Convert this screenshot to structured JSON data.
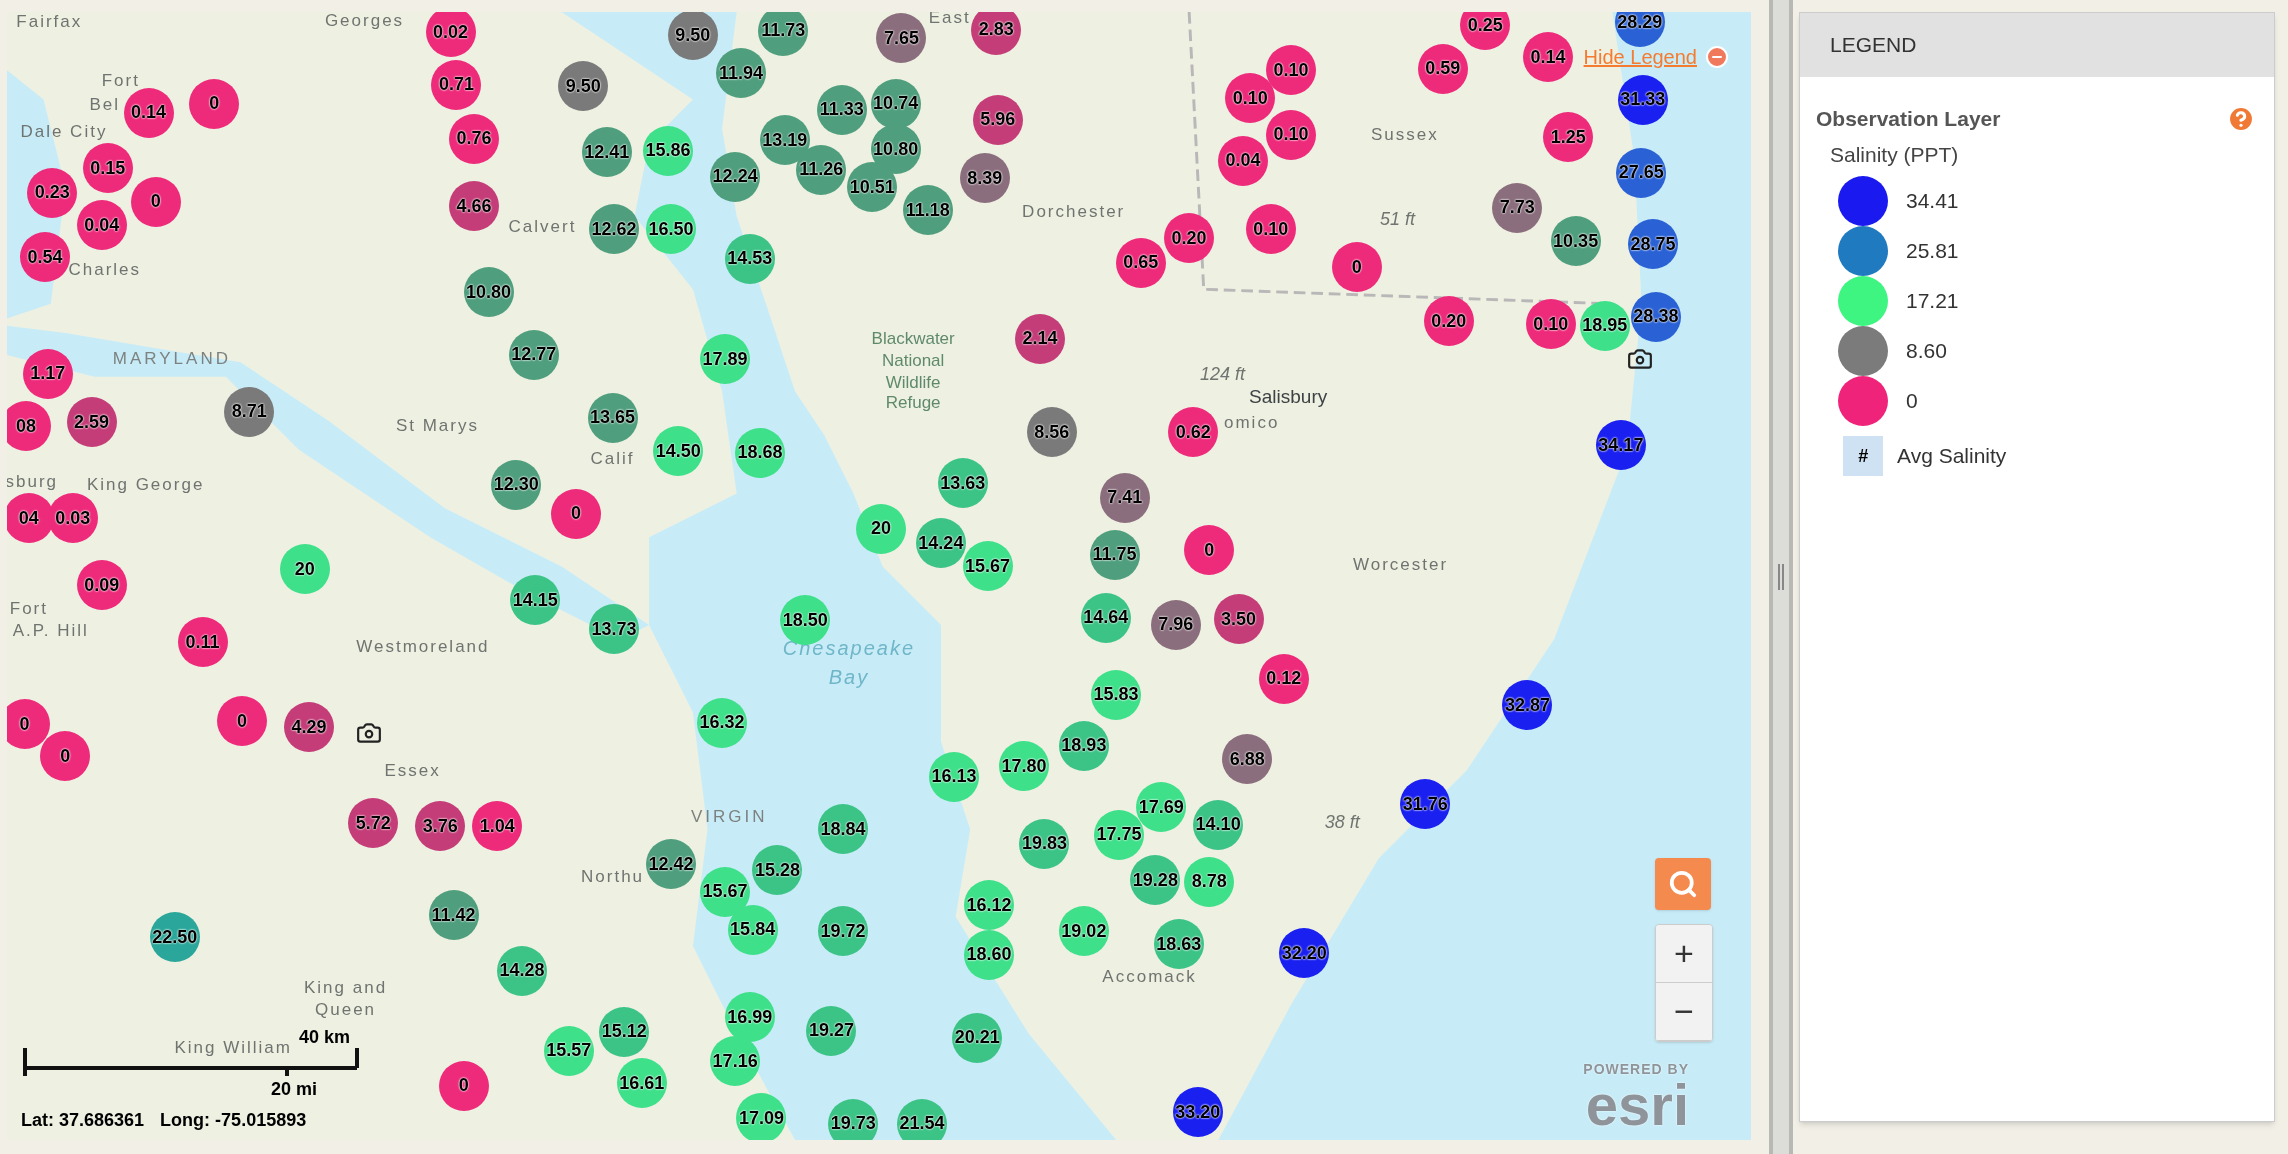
{
  "map": {
    "labels": [
      {
        "text": "Fairfax",
        "kind": "place"
      },
      {
        "text": "Georges",
        "kind": "place"
      },
      {
        "text": "East",
        "kind": "place"
      },
      {
        "text": "Fort",
        "kind": "place"
      },
      {
        "text": "Bel",
        "kind": "place"
      },
      {
        "text": "Dale City",
        "kind": "place"
      },
      {
        "text": "Charles",
        "kind": "place"
      },
      {
        "text": "Calvert",
        "kind": "place"
      },
      {
        "text": "MARYLAND",
        "kind": "state"
      },
      {
        "text": "St Marys",
        "kind": "place"
      },
      {
        "text": "Calif",
        "kind": "place"
      },
      {
        "text": "sburg",
        "kind": "place"
      },
      {
        "text": "King George",
        "kind": "place"
      },
      {
        "text": "Fort",
        "kind": "place"
      },
      {
        "text": "A.P. Hill",
        "kind": "place"
      },
      {
        "text": "Westmoreland",
        "kind": "place"
      },
      {
        "text": "Essex",
        "kind": "place"
      },
      {
        "text": "Northu",
        "kind": "place"
      },
      {
        "text": "VIRGIN",
        "kind": "state"
      },
      {
        "text": "King and",
        "kind": "place"
      },
      {
        "text": "Queen",
        "kind": "place"
      },
      {
        "text": "King William",
        "kind": "place"
      },
      {
        "text": "Blackwater",
        "kind": "refuge"
      },
      {
        "text": "National",
        "kind": "refuge"
      },
      {
        "text": "Wildlife",
        "kind": "refuge"
      },
      {
        "text": "Refuge",
        "kind": "refuge"
      },
      {
        "text": "Dorchester",
        "kind": "place"
      },
      {
        "text": "Sussex",
        "kind": "place"
      },
      {
        "text": "51 ft",
        "kind": "elevation"
      },
      {
        "text": "124 ft",
        "kind": "elevation"
      },
      {
        "text": "Salisbury",
        "kind": "town"
      },
      {
        "text": "omico",
        "kind": "place"
      },
      {
        "text": "Worcester",
        "kind": "place"
      },
      {
        "text": "Chesapeake",
        "kind": "water"
      },
      {
        "text": "Bay",
        "kind": "water"
      },
      {
        "text": "38 ft",
        "kind": "elevation"
      },
      {
        "text": "Accomack",
        "kind": "place"
      }
    ],
    "markers": [
      {
        "value": "0.02",
        "color": "#ee2a7b"
      },
      {
        "value": "0.14",
        "color": "#ee2a7b"
      },
      {
        "value": "0",
        "color": "#ee2a7b"
      },
      {
        "value": "0.71",
        "color": "#ee2a7b"
      },
      {
        "value": "0.76",
        "color": "#ee2a7b"
      },
      {
        "value": "0.15",
        "color": "#ee2a7b"
      },
      {
        "value": "0.23",
        "color": "#ee2a7b"
      },
      {
        "value": "0",
        "color": "#ee2a7b"
      },
      {
        "value": "0.04",
        "color": "#ee2a7b"
      },
      {
        "value": "0.54",
        "color": "#ee2a7b"
      },
      {
        "value": "4.66",
        "color": "#c43d78"
      },
      {
        "value": "9.50",
        "color": "#7a7a7a"
      },
      {
        "value": "9.50",
        "color": "#7a7a7a"
      },
      {
        "value": "11.73",
        "color": "#4f9f7e"
      },
      {
        "value": "7.65",
        "color": "#8b6e7d"
      },
      {
        "value": "2.83",
        "color": "#c43d78"
      },
      {
        "value": "11.94",
        "color": "#4f9f7e"
      },
      {
        "value": "11.33",
        "color": "#4f9f7e"
      },
      {
        "value": "10.74",
        "color": "#4f9f7e"
      },
      {
        "value": "12.41",
        "color": "#4f9f7e"
      },
      {
        "value": "15.86",
        "color": "#3ee08a"
      },
      {
        "value": "13.19",
        "color": "#4f9f7e"
      },
      {
        "value": "10.80",
        "color": "#4f9f7e"
      },
      {
        "value": "12.24",
        "color": "#4f9f7e"
      },
      {
        "value": "11.26",
        "color": "#4f9f7e"
      },
      {
        "value": "10.51",
        "color": "#4f9f7e"
      },
      {
        "value": "5.96",
        "color": "#c43d78"
      },
      {
        "value": "8.39",
        "color": "#8b6e7d"
      },
      {
        "value": "11.18",
        "color": "#4f9f7e"
      },
      {
        "value": "12.62",
        "color": "#4f9f7e"
      },
      {
        "value": "16.50",
        "color": "#3ee08a"
      },
      {
        "value": "14.53",
        "color": "#3cc487"
      },
      {
        "value": "10.80",
        "color": "#4f9f7e"
      },
      {
        "value": "12.77",
        "color": "#4f9f7e"
      },
      {
        "value": "17.89",
        "color": "#3ee08a"
      },
      {
        "value": "1.17",
        "color": "#ee2a7b"
      },
      {
        "value": "08",
        "color": "#ee2a7b"
      },
      {
        "value": "2.59",
        "color": "#c43d78"
      },
      {
        "value": "8.71",
        "color": "#7a7a7a"
      },
      {
        "value": "13.65",
        "color": "#4f9f7e"
      },
      {
        "value": "14.50",
        "color": "#3ee08a"
      },
      {
        "value": "18.68",
        "color": "#3ee08a"
      },
      {
        "value": "12.30",
        "color": "#4f9f7e"
      },
      {
        "value": "04",
        "color": "#ee2a7b"
      },
      {
        "value": "0.03",
        "color": "#ee2a7b"
      },
      {
        "value": "0",
        "color": "#ee2a7b"
      },
      {
        "value": "0.09",
        "color": "#ee2a7b"
      },
      {
        "value": "20",
        "color": "#3ee08a"
      },
      {
        "value": "0.11",
        "color": "#ee2a7b"
      },
      {
        "value": "14.15",
        "color": "#3cc487"
      },
      {
        "value": "13.73",
        "color": "#3cc487"
      },
      {
        "value": "18.50",
        "color": "#3ee08a"
      },
      {
        "value": "0",
        "color": "#ee2a7b"
      },
      {
        "value": "0",
        "color": "#ee2a7b"
      },
      {
        "value": "0",
        "color": "#ee2a7b"
      },
      {
        "value": "4.29",
        "color": "#c43d78"
      },
      {
        "value": "16.32",
        "color": "#3ee08a"
      },
      {
        "value": "5.72",
        "color": "#c43d78"
      },
      {
        "value": "3.76",
        "color": "#c43d78"
      },
      {
        "value": "1.04",
        "color": "#ee2a7b"
      },
      {
        "value": "22.50",
        "color": "#2aa79a"
      },
      {
        "value": "11.42",
        "color": "#4f9f7e"
      },
      {
        "value": "12.42",
        "color": "#4f9f7e"
      },
      {
        "value": "15.67",
        "color": "#3ee08a"
      },
      {
        "value": "15.28",
        "color": "#3cc487"
      },
      {
        "value": "18.84",
        "color": "#3cc487"
      },
      {
        "value": "15.84",
        "color": "#3ee08a"
      },
      {
        "value": "19.72",
        "color": "#3cc487"
      },
      {
        "value": "14.28",
        "color": "#3cc487"
      },
      {
        "value": "15.57",
        "color": "#3ee08a"
      },
      {
        "value": "15.12",
        "color": "#3cc487"
      },
      {
        "value": "16.61",
        "color": "#3ee08a"
      },
      {
        "value": "16.99",
        "color": "#3ee08a"
      },
      {
        "value": "17.16",
        "color": "#3ee08a"
      },
      {
        "value": "19.27",
        "color": "#3cc487"
      },
      {
        "value": "17.09",
        "color": "#3ee08a"
      },
      {
        "value": "19.73",
        "color": "#3cc487"
      },
      {
        "value": "0",
        "color": "#ee2a7b"
      },
      {
        "value": "13.63",
        "color": "#3cc487"
      },
      {
        "value": "20",
        "color": "#3ee08a"
      },
      {
        "value": "14.24",
        "color": "#3cc487"
      },
      {
        "value": "15.67",
        "color": "#3ee08a"
      },
      {
        "value": "2.14",
        "color": "#c43d78"
      },
      {
        "value": "8.56",
        "color": "#7a7a7a"
      },
      {
        "value": "7.41",
        "color": "#8b6e7d"
      },
      {
        "value": "11.75",
        "color": "#4f9f7e"
      },
      {
        "value": "0.62",
        "color": "#ee2a7b"
      },
      {
        "value": "0",
        "color": "#ee2a7b"
      },
      {
        "value": "14.64",
        "color": "#3cc487"
      },
      {
        "value": "7.96",
        "color": "#8b6e7d"
      },
      {
        "value": "3.50",
        "color": "#c43d78"
      },
      {
        "value": "0.12",
        "color": "#ee2a7b"
      },
      {
        "value": "15.83",
        "color": "#3ee08a"
      },
      {
        "value": "16.13",
        "color": "#3ee08a"
      },
      {
        "value": "17.80",
        "color": "#3ee08a"
      },
      {
        "value": "18.93",
        "color": "#3cc487"
      },
      {
        "value": "6.88",
        "color": "#8b6e7d"
      },
      {
        "value": "17.69",
        "color": "#3ee08a"
      },
      {
        "value": "14.10",
        "color": "#3cc487"
      },
      {
        "value": "19.83",
        "color": "#3cc487"
      },
      {
        "value": "17.75",
        "color": "#3ee08a"
      },
      {
        "value": "19.28",
        "color": "#3cc487"
      },
      {
        "value": "8.78",
        "color": "#3ee08a"
      },
      {
        "value": "16.12",
        "color": "#3ee08a"
      },
      {
        "value": "18.60",
        "color": "#3ee08a"
      },
      {
        "value": "19.02",
        "color": "#3ee08a"
      },
      {
        "value": "18.63",
        "color": "#3cc487"
      },
      {
        "value": "20.21",
        "color": "#3cc487"
      },
      {
        "value": "21.54",
        "color": "#3cc487"
      },
      {
        "value": "33.20",
        "color": "#1a20f0"
      },
      {
        "value": "32.20",
        "color": "#1a20f0"
      },
      {
        "value": "31.76",
        "color": "#1a20f0"
      },
      {
        "value": "32.87",
        "color": "#1a20f0"
      },
      {
        "value": "34.17",
        "color": "#1a20f0"
      },
      {
        "value": "0.65",
        "color": "#ee2a7b"
      },
      {
        "value": "0.20",
        "color": "#ee2a7b"
      },
      {
        "value": "0.10",
        "color": "#ee2a7b"
      },
      {
        "value": "0.04",
        "color": "#ee2a7b"
      },
      {
        "value": "0.10",
        "color": "#ee2a7b"
      },
      {
        "value": "0.10",
        "color": "#ee2a7b"
      },
      {
        "value": "0.10",
        "color": "#ee2a7b"
      },
      {
        "value": "0",
        "color": "#ee2a7b"
      },
      {
        "value": "0.59",
        "color": "#ee2a7b"
      },
      {
        "value": "0.25",
        "color": "#ee2a7b"
      },
      {
        "value": "0.14",
        "color": "#ee2a7b"
      },
      {
        "value": "1.25",
        "color": "#ee2a7b"
      },
      {
        "value": "7.73",
        "color": "#8b6e7d"
      },
      {
        "value": "10.35",
        "color": "#4f9f7e"
      },
      {
        "value": "0.20",
        "color": "#ee2a7b"
      },
      {
        "value": "0.10",
        "color": "#ee2a7b"
      },
      {
        "value": "18.95",
        "color": "#3ee08a"
      },
      {
        "value": "28.29",
        "color": "#2a62d6"
      },
      {
        "value": "31.33",
        "color": "#1a20f0"
      },
      {
        "value": "27.65",
        "color": "#2a62d6"
      },
      {
        "value": "28.75",
        "color": "#2a62d6"
      },
      {
        "value": "28.38",
        "color": "#2a62d6"
      }
    ],
    "hide_legend_link": "Hide Legend",
    "scale_bar": {
      "km": "40 km",
      "mi": "20 mi"
    },
    "coordinates": {
      "lat_label": "Lat:",
      "lat": "37.686361",
      "long_label": "Long:",
      "long": "-75.015893"
    },
    "zoom_buttons": [
      "+",
      "−"
    ],
    "attribution": {
      "top": "POWERED BY",
      "logo": "esri"
    }
  },
  "legend": {
    "title": "LEGEND",
    "layer": "Observation Layer",
    "subtitle": "Salinity (PPT)",
    "items": [
      {
        "label": "34.41",
        "color": "#1a1af0"
      },
      {
        "label": "25.81",
        "color": "#1f7ac0"
      },
      {
        "label": "17.21",
        "color": "#3ef582"
      },
      {
        "label": "8.60",
        "color": "#7b7b7b"
      },
      {
        "label": "0",
        "color": "#f0237a"
      }
    ],
    "avg": {
      "symbol": "#",
      "label": "Avg Salinity"
    }
  }
}
